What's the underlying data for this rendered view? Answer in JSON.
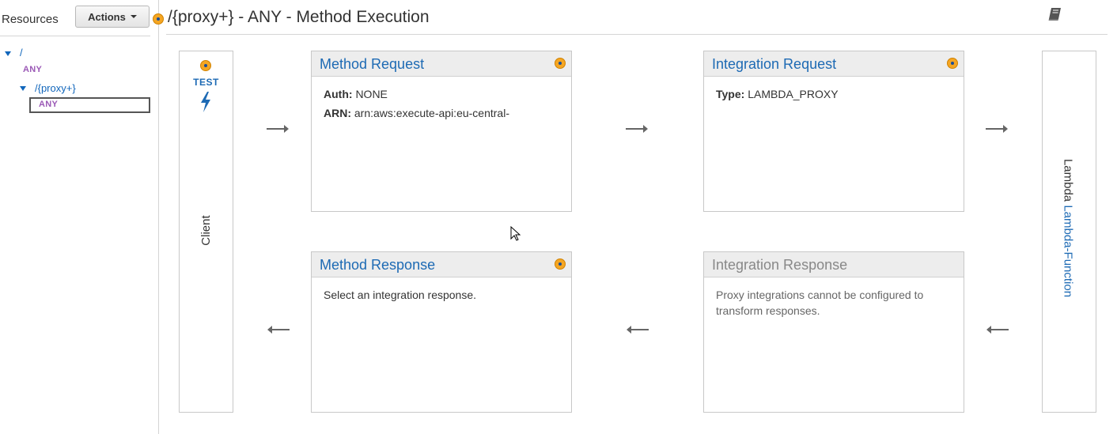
{
  "sidebar": {
    "resources_label": "Resources",
    "actions_label": "Actions",
    "tree": {
      "root": "/",
      "root_method": "ANY",
      "proxy": "/{proxy+}",
      "proxy_method": "ANY"
    }
  },
  "header": {
    "title": "/{proxy+} - ANY - Method Execution"
  },
  "client": {
    "test_label": "TEST",
    "label": "Client"
  },
  "method_request": {
    "title": "Method Request",
    "auth_key": "Auth:",
    "auth_value": "NONE",
    "arn_key": "ARN:",
    "arn_value": "arn:aws:execute-api:eu-central-"
  },
  "integration_request": {
    "title": "Integration Request",
    "type_key": "Type:",
    "type_value": "LAMBDA_PROXY"
  },
  "method_response": {
    "title": "Method Response",
    "body": "Select an integration response."
  },
  "integration_response": {
    "title": "Integration Response",
    "body": "Proxy integrations cannot be configured to transform responses."
  },
  "lambda": {
    "prefix": "Lambda",
    "function_name": "Lambda-Function"
  },
  "colors": {
    "accent": "#1d6ab4",
    "dot": "#f5a623",
    "method": "#9b59b6"
  },
  "icons": [
    "book-icon",
    "bolt-icon",
    "arrow-right-icon",
    "arrow-left-icon",
    "status-dot-icon"
  ]
}
